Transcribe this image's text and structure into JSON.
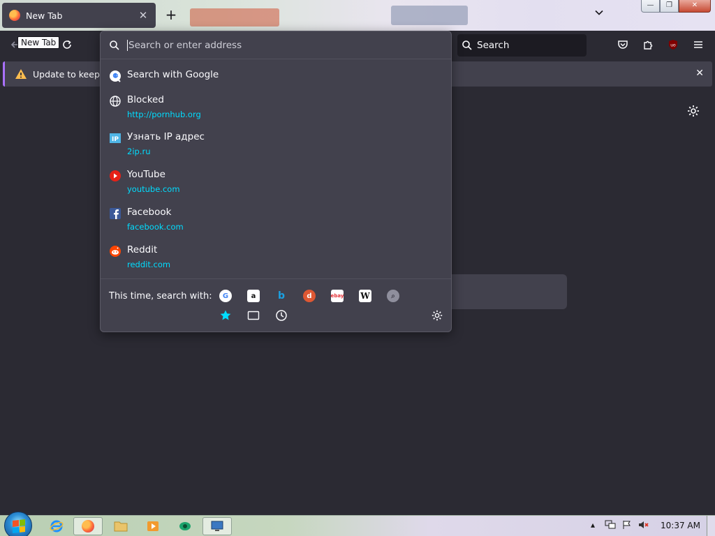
{
  "browser": {
    "tab": {
      "title": "New Tab",
      "close_glyph": "✕"
    },
    "new_tab_glyph": "+",
    "list_all_tabs_glyph": "⌄",
    "window_controls": {
      "minimize": "—",
      "restore": "❐",
      "close": "✕"
    }
  },
  "toolbar": {
    "tooltip": "New Tab",
    "search_label": "Search",
    "account_badge": "uo"
  },
  "notification": {
    "text": "Update to keep usi",
    "close_glyph": "✕"
  },
  "urlbar": {
    "placeholder": "Search or enter address",
    "value": ""
  },
  "results": [
    {
      "title": "Search with Google",
      "url": "",
      "icon": "google-icon"
    },
    {
      "title": "Blocked",
      "url": "http://pornhub.org",
      "icon": "globe-icon"
    },
    {
      "title": "Узнать IP адрес",
      "url": "2ip.ru",
      "icon": "ip-icon"
    },
    {
      "title": "YouTube",
      "url": "youtube.com",
      "icon": "youtube-icon"
    },
    {
      "title": "Facebook",
      "url": "facebook.com",
      "icon": "facebook-icon"
    },
    {
      "title": "Reddit",
      "url": "reddit.com",
      "icon": "reddit-icon"
    }
  ],
  "oneoff": {
    "label": "This time, search with:",
    "engines": [
      "google",
      "amazon",
      "bing",
      "duckduckgo",
      "ebay",
      "wikipedia",
      "search"
    ],
    "modes": [
      "bookmarks",
      "tabs",
      "history"
    ]
  },
  "taskbar": {
    "clock": "10:37 AM",
    "items": [
      "internet-explorer",
      "firefox",
      "explorer",
      "media-player",
      "app",
      "remote-desktop"
    ]
  },
  "colors": {
    "accent": "#00ddff",
    "panel": "#42414d",
    "background": "#2b2a33"
  }
}
